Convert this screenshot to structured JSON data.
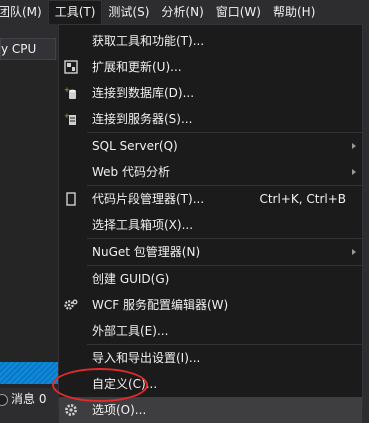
{
  "menubar": {
    "items": [
      {
        "label": "团队(M)"
      },
      {
        "label": "工具(T)",
        "active": true
      },
      {
        "label": "测试(S)"
      },
      {
        "label": "分析(N)"
      },
      {
        "label": "窗口(W)"
      },
      {
        "label": "帮助(H)"
      }
    ]
  },
  "toolbar": {
    "platform_value": "y CPU"
  },
  "status": {
    "messages_label": "消息 0"
  },
  "tools_menu": {
    "items": [
      {
        "label": "获取工具和功能(T)...",
        "icon": "none"
      },
      {
        "label": "扩展和更新(U)...",
        "icon": "extensions-icon"
      },
      {
        "label": "连接到数据库(D)...",
        "icon": "connect-database-icon"
      },
      {
        "label": "连接到服务器(S)...",
        "icon": "connect-server-icon"
      },
      {
        "label": "SQL Server(Q)",
        "icon": "none",
        "submenu": true
      },
      {
        "label": "Web 代码分析",
        "icon": "none",
        "submenu": true
      },
      {
        "label": "代码片段管理器(T)...",
        "icon": "snippet-icon",
        "shortcut": "Ctrl+K, Ctrl+B"
      },
      {
        "label": "选择工具箱项(X)...",
        "icon": "none"
      },
      {
        "label": "NuGet 包管理器(N)",
        "icon": "none",
        "submenu": true
      },
      {
        "label": "创建 GUID(G)",
        "icon": "none"
      },
      {
        "label": "WCF 服务配置编辑器(W)",
        "icon": "wcf-gear-icon"
      },
      {
        "label": "外部工具(E)...",
        "icon": "none"
      },
      {
        "label": "导入和导出设置(I)...",
        "icon": "none"
      },
      {
        "label": "自定义(C)...",
        "icon": "none"
      },
      {
        "label": "选项(O)...",
        "icon": "options-gear-icon",
        "highlighted": true
      }
    ]
  },
  "colors": {
    "menu_bg": "#1b1b1c",
    "shell_bg": "#2d2d30",
    "hover_bg": "#3e3e40",
    "accent_blue": "#007acc",
    "annotation_red": "#e22a2a"
  }
}
